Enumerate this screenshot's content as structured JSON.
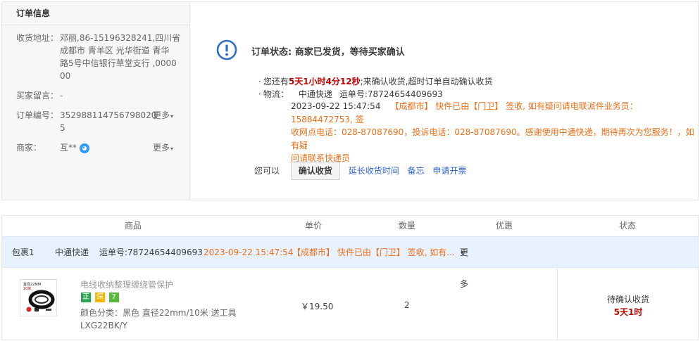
{
  "order_info": {
    "title": "订单信息",
    "address_label": "收货地址：",
    "address_lines": [
      "邓丽,86-15196328241,四川省",
      "成都市 青羊区 光华街道 青华",
      "路5号中信银行草堂支行 ,0000",
      "00"
    ],
    "message_label": "买家留言：",
    "message_value": "-",
    "order_no_label": "订单编号：",
    "order_no_lines": [
      "352988114756798020",
      "5"
    ],
    "more_label_1": "更多",
    "seller_label": "商家：",
    "seller_value": "互**",
    "more_label_2": "更多"
  },
  "status": {
    "title": "订单状态: 商家已发货，等待买家确认",
    "countdown_prefix": "您还有",
    "countdown": "5天1小时4分12秒",
    "countdown_suffix": ";来确认收货,超时订单自动确认收货",
    "logistics_label": "物流：",
    "carrier": "中通快递",
    "tracking": "运单号:78724654409693",
    "log_time": "2023-09-22 15:47:54",
    "log_lines": [
      "【成都市】 快件已由【门卫】 签收, 如有疑问请电联派件业务员：15884472753, 签",
      "收网点电话：028-87087690，投诉电话：028-87087690。感谢使用中通快递，期待再次为您服务！，如有疑",
      "问请联系快递员"
    ],
    "actions_label": "您可以",
    "confirm_button": "确认收货",
    "extend_link": "延长收货时间",
    "memo_link": "备忘",
    "invoice_link": "申请开票"
  },
  "table": {
    "headers": {
      "product": "商品",
      "price": "单价",
      "qty": "数量",
      "discount": "优惠",
      "status": "状态"
    },
    "package": {
      "label": "包裹1",
      "carrier": "中通快递",
      "tracking": "运单号:78724654409693",
      "time": "2023-09-22 15:47:54",
      "summary": "【成都市】 快件已由【门卫】 签收, 如有...",
      "more": "更多"
    },
    "item": {
      "title": "电线收纳整理缠绕管保护",
      "badges": [
        "正",
        "保",
        "7"
      ],
      "attr_line_1": "颜色分类：黑色 直径22mm/10米 送工具",
      "attr_line_2": "LXG22BK/Y",
      "price": "￥19.50",
      "qty": "2",
      "status_text": "待确认收货",
      "status_countdown": "5天1时",
      "thumb_label": "直径22MM",
      "thumb_label_2": "10米"
    }
  },
  "colors": {
    "accent_red": "#c40000",
    "log_orange": "#f16e16",
    "link_blue": "#3366cc",
    "warn_blue": "#2d6fc4",
    "package_bg": "#e8f2ff"
  }
}
